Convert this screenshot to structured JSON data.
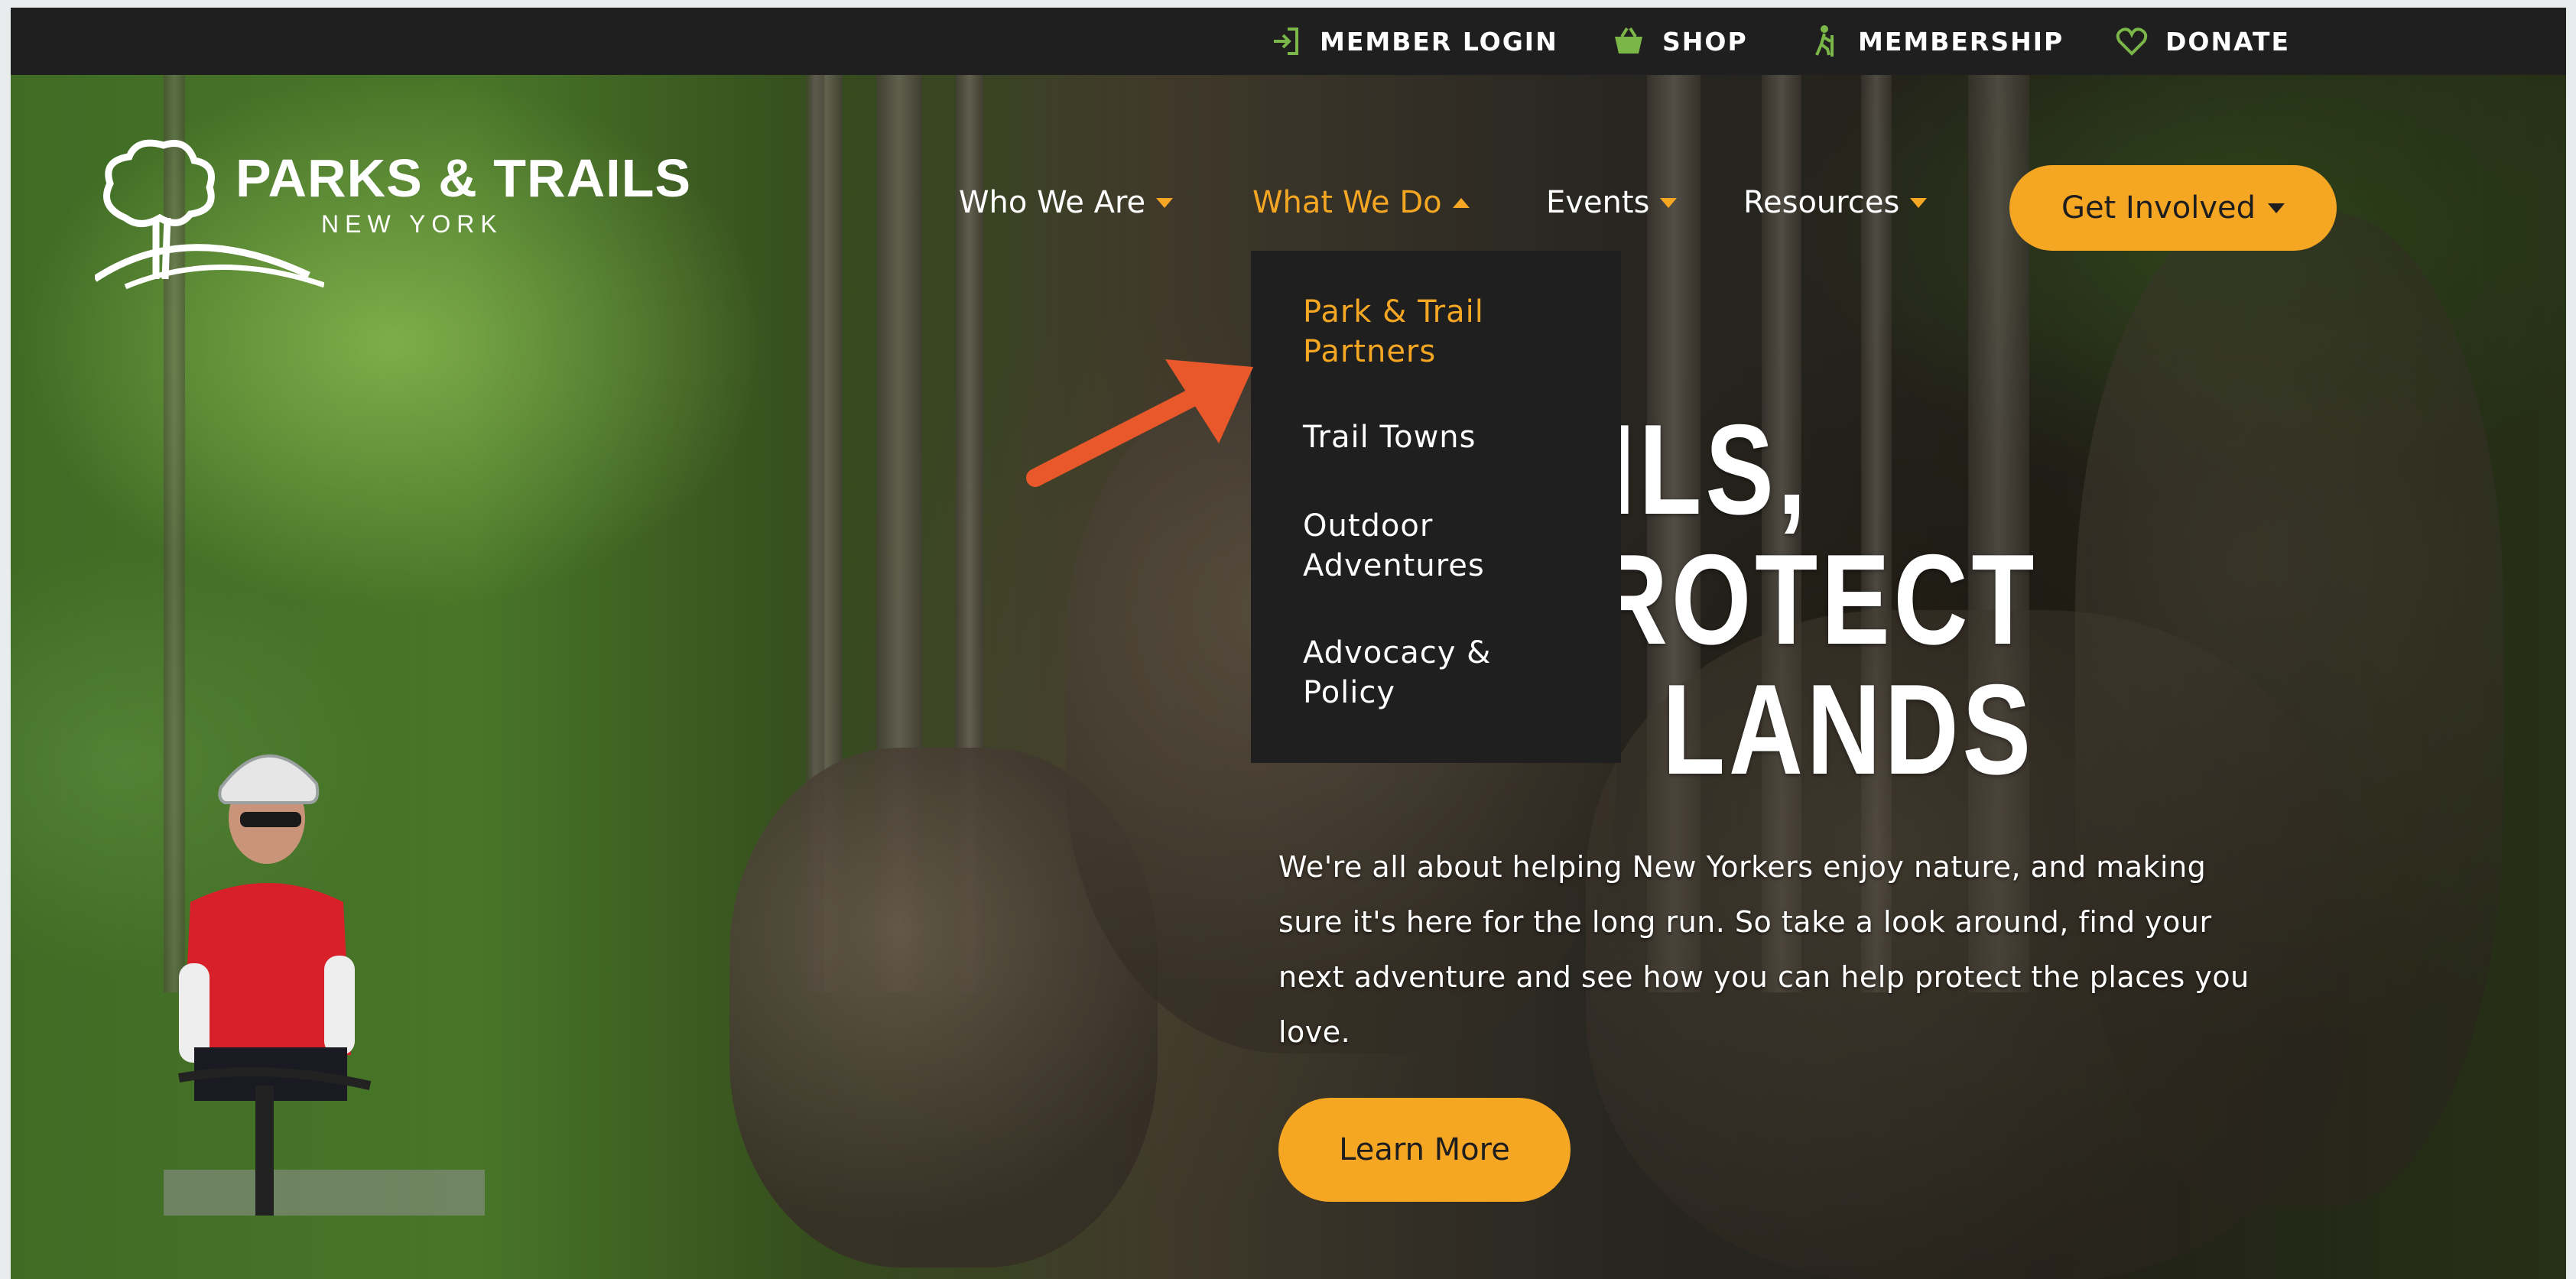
{
  "utility_nav": {
    "member_login": "MEMBER LOGIN",
    "shop": "SHOP",
    "membership": "MEMBERSHIP",
    "donate": "DONATE"
  },
  "logo": {
    "name": "PARKS & TRAILS",
    "sub": "NEW YORK"
  },
  "main_nav": {
    "who_we_are": "Who We Are",
    "what_we_do": "What We Do",
    "events": "Events",
    "resources": "Resources",
    "get_involved": "Get Involved"
  },
  "dropdown": {
    "items": [
      {
        "label": "Park & Trail Partners"
      },
      {
        "label": "Trail Towns"
      },
      {
        "label": "Outdoor Adventures"
      },
      {
        "label": "Advocacy & Policy"
      }
    ]
  },
  "hero": {
    "headline_line1": "E TRAILS,",
    "headline_line2": "ELP PROTECT",
    "headline_line3": "LANDS",
    "body": "We're all about helping New Yorkers enjoy nature, and making sure it's here for the long run. So take a look around, find your next adventure and see how you can help protect the places you love.",
    "cta": "Learn More"
  },
  "colors": {
    "accent": "#f5a623",
    "dark_bar": "#1f1f1f",
    "annotation_arrow": "#e8582a",
    "login_icon": "#7ab648"
  }
}
